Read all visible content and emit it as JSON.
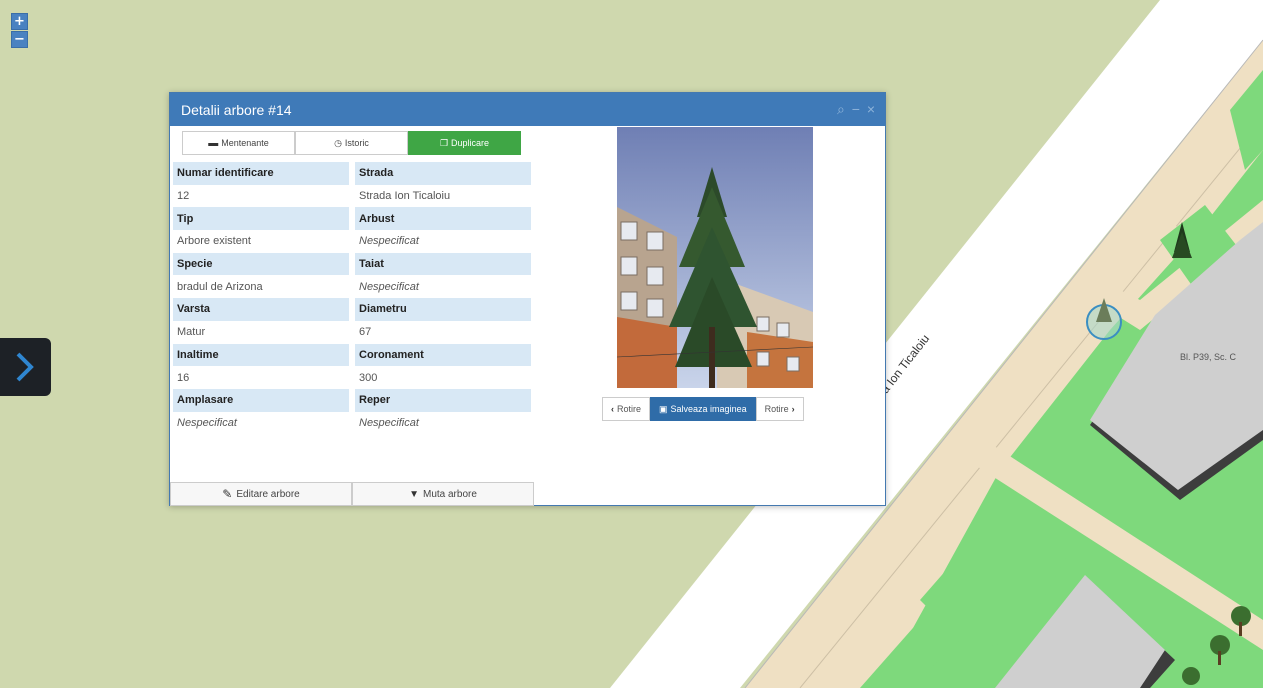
{
  "map": {
    "zoom_in": "+",
    "zoom_out": "−",
    "street_label": "Strada Ion Ticaloiu",
    "building_label": "Bl. P39, Sc. C",
    "colors": {
      "land": "#cfd8ae",
      "road": "#ffffff",
      "sidewalk": "#efe0c3",
      "green": "#7ed97c",
      "building": "#cfcfcf",
      "building_shadow": "#3d3d3d"
    }
  },
  "panel": {
    "title": "Detalii arbore #14",
    "controls": [
      "search-icon",
      "minimize-icon",
      "close-icon"
    ],
    "tabs": [
      {
        "label": "Mentenante",
        "icon": "truck-icon",
        "active": false
      },
      {
        "label": "Istoric",
        "icon": "clock-icon",
        "active": false
      },
      {
        "label": "Duplicare",
        "icon": "copy-icon",
        "active": true
      }
    ],
    "fields": [
      {
        "label": "Numar identificare",
        "value": "12"
      },
      {
        "label": "Strada",
        "value": "Strada Ion Ticaloiu"
      },
      {
        "label": "Tip",
        "value": "Arbore existent"
      },
      {
        "label": "Arbust",
        "value": "Nespecificat"
      },
      {
        "label": "Specie",
        "value": "bradul de Arizona"
      },
      {
        "label": "Taiat",
        "value": "Nespecificat"
      },
      {
        "label": "Varsta",
        "value": "Matur"
      },
      {
        "label": "Diametru",
        "value": "67"
      },
      {
        "label": "Inaltime",
        "value": "16"
      },
      {
        "label": "Coronament",
        "value": "300"
      },
      {
        "label": "Amplasare",
        "value": "Nespecificat"
      },
      {
        "label": "Reper",
        "value": "Nespecificat"
      }
    ],
    "edit_button": "Editare arbore",
    "move_button": "Muta arbore",
    "image_buttons": {
      "rotate_left": "Rotire",
      "save": "Salveaza imaginea",
      "rotate_right": "Rotire"
    }
  }
}
